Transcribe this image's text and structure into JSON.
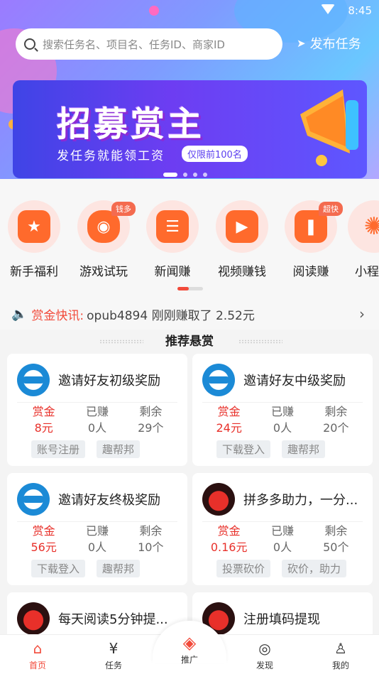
{
  "status": {
    "time": "8:45"
  },
  "search": {
    "placeholder": "搜索任务名、项目名、任务ID、商家ID"
  },
  "header": {
    "publish_label": "发布任务"
  },
  "banner": {
    "title": "招募赏主",
    "subtitle": "发任务就能领工资",
    "tag": "仅限前100名",
    "active_slide": 1,
    "slide_count": 4
  },
  "categories": [
    {
      "label": "新手福利",
      "icon": "medal-icon",
      "glyph": "★",
      "badge": ""
    },
    {
      "label": "游戏试玩",
      "icon": "gamepad-icon",
      "glyph": "◉",
      "badge": "钱多"
    },
    {
      "label": "新闻赚",
      "icon": "news-icon",
      "glyph": "☰",
      "badge": ""
    },
    {
      "label": "视频赚钱",
      "icon": "video-icon",
      "glyph": "▶",
      "badge": ""
    },
    {
      "label": "阅读赚",
      "icon": "book-icon",
      "glyph": "❚",
      "badge": "超快"
    },
    {
      "label": "小程",
      "icon": "sun-icon",
      "glyph": "✺",
      "badge": ""
    }
  ],
  "news": {
    "label": "赏金快讯:",
    "text": "opub4894 刚刚赚取了 2.52元"
  },
  "section": {
    "title": "推荐悬赏"
  },
  "stat_labels": {
    "reward": "赏金",
    "earned": "已赚",
    "remaining": "剩余"
  },
  "tasks": [
    {
      "title": "邀请好友初级奖励",
      "logo": "blue",
      "reward": "8元",
      "earned": "0人",
      "remaining": "29个",
      "tags": [
        "账号注册",
        "趣帮邦"
      ]
    },
    {
      "title": "邀请好友中级奖励",
      "logo": "blue",
      "reward": "24元",
      "earned": "0人",
      "remaining": "20个",
      "tags": [
        "下载登入",
        "趣帮邦"
      ]
    },
    {
      "title": "邀请好友终极奖励",
      "logo": "blue",
      "reward": "56元",
      "earned": "0人",
      "remaining": "10个",
      "tags": [
        "下载登入",
        "趣帮邦"
      ]
    },
    {
      "title": "拼多多助力，一分...",
      "logo": "red",
      "reward": "0.16元",
      "earned": "0人",
      "remaining": "50个",
      "tags": [
        "投票砍价",
        "砍价，助力"
      ]
    },
    {
      "title": "每天阅读5分钟提...",
      "logo": "red",
      "reward": "",
      "earned": "",
      "remaining": "",
      "tags": []
    },
    {
      "title": "注册填码提现",
      "logo": "red",
      "reward": "",
      "earned": "",
      "remaining": "",
      "tags": []
    }
  ],
  "tabs": [
    {
      "label": "首页",
      "icon": "home-icon",
      "active": true
    },
    {
      "label": "任务",
      "icon": "money-bag-icon",
      "active": false
    },
    {
      "label": "推广",
      "icon": "layers-icon",
      "active": false
    },
    {
      "label": "发现",
      "icon": "compass-icon",
      "active": false
    },
    {
      "label": "我的",
      "icon": "user-icon",
      "active": false
    }
  ],
  "colors": {
    "accent": "#f24a3a",
    "orange": "#ff6a2c"
  }
}
